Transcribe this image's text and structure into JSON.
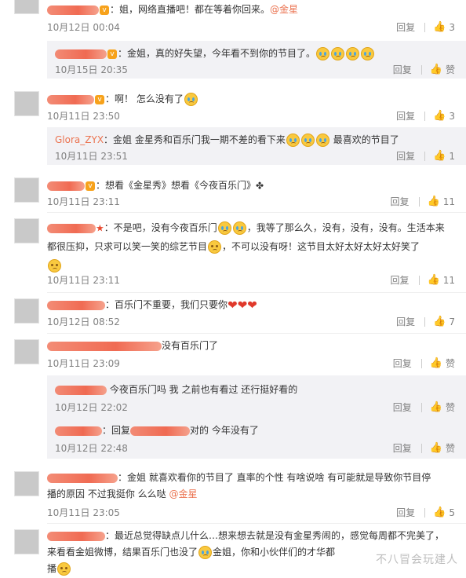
{
  "labels": {
    "reply": "回复",
    "like": "赞"
  },
  "comments": [
    {
      "text": "：姐，网络直播吧！都在等着你回来。",
      "mention": "@金星",
      "time": "10月12日 00:04",
      "likes": "3",
      "subs": [
        {
          "text": "：金姐，真的好失望，今年看不到你的节目了。",
          "time": "10月15日 20:35",
          "likes": ""
        }
      ]
    },
    {
      "text": "：啊！ 怎么没有了",
      "time": "10月11日 23:50",
      "likes": "3",
      "subs": [
        {
          "name": "Glora_ZYX",
          "text": "：金姐 金星秀和百乐门我一期不差的看下来",
          "text_after": "最喜欢的节目了",
          "time": "10月11日 23:51",
          "likes": "1"
        }
      ]
    },
    {
      "text": "：想看《金星秀》想看《今夜百乐门》",
      "time": "10月11日 23:11",
      "likes": "11"
    },
    {
      "text": "：不是吧，没有今夜百乐门",
      "text_b": "，我等了那么久，没有，没有，没有。生活本来",
      "text_c": "都很压抑，只求可以笑一笑的综艺节目",
      "text_d": "，不可以没有呀！这节目太好太好太好太好笑了",
      "time": "10月11日 23:11",
      "likes": "11"
    },
    {
      "text": "：百乐门不重要，我们只要你",
      "time": "10月12日 08:52",
      "likes": "7"
    },
    {
      "text": "没有百乐门了",
      "time": "10月11日 23:09",
      "likes": "赞",
      "subs": [
        {
          "text": "今夜百乐门吗 我 之前也有看过 还行挺好看的",
          "time": "10月12日 22:02",
          "likes": "赞"
        },
        {
          "text": "：回复",
          "text_b": "对的 今年没有了",
          "time": "10月12日 22:48",
          "likes": "赞"
        }
      ]
    },
    {
      "text": "：金姐 就喜欢看你的节目了 直率的个性 有啥说啥 有可能就是导致你节目停",
      "text_b": "播的原因 不过我挺你 么么哒",
      "mention": "@金星",
      "time": "10月11日 23:05",
      "likes": "5"
    },
    {
      "text": "：最近总觉得缺点儿什么…想来想去就是没有金星秀闹的，感觉每周都不完美了，",
      "text_b": "来看看金姐微博，结果百乐门也没了",
      "text_c": "金姐，你和小伙伴们的才华都",
      "text_d": "播"
    }
  ],
  "watermark": "不八冒会玩建人"
}
